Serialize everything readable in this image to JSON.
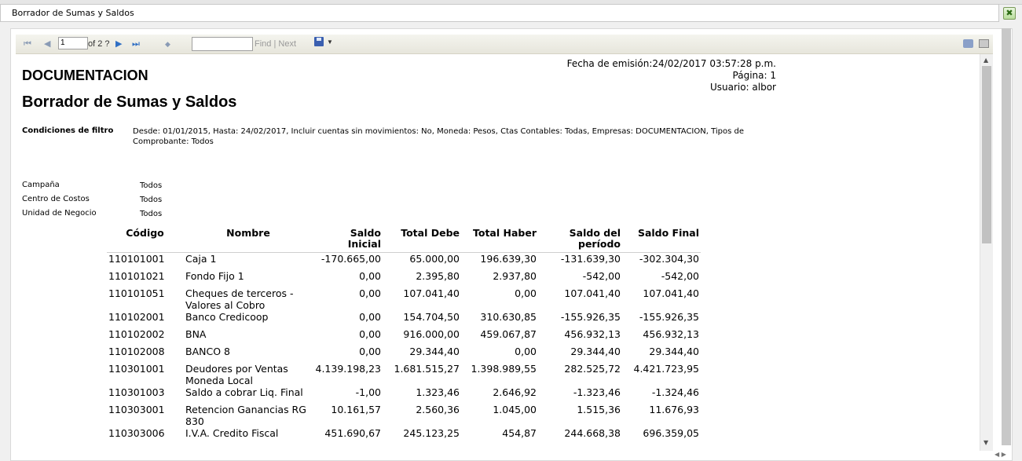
{
  "window": {
    "title": "Borrador de Sumas y Saldos",
    "close_label": "✖"
  },
  "toolbar": {
    "first_icon": "⏮",
    "prev_icon": "◀",
    "page_value": "1",
    "of_text": "of 2 ?",
    "next_icon": "▶",
    "last_icon": "⏭",
    "back_icon": "◆",
    "find_value": "",
    "find_label": "Find",
    "separator": "|",
    "next_label": "Next",
    "export_arrow": "▼"
  },
  "report": {
    "company": "DOCUMENTACION",
    "title": "Borrador de Sumas y Saldos",
    "meta": {
      "fecha": "Fecha de emisión:24/02/2017 03:57:28 p.m.",
      "pagina": "Página: 1",
      "usuario": "Usuario: albor"
    },
    "filter_label": "Condiciones de filtro",
    "filter_text": "Desde: 01/01/2015, Hasta: 24/02/2017, Incluir cuentas sin movimientos: No, Moneda: Pesos, Ctas Contables: Todas, Empresas: DOCUMENTACION, Tipos de Comprobante: Todos",
    "params": [
      {
        "label": "Campaña",
        "value": "Todos"
      },
      {
        "label": "Centro de Costos",
        "value": "Todos"
      },
      {
        "label": "Unidad de Negocio",
        "value": "Todos"
      }
    ],
    "columns": [
      "Código",
      "Nombre",
      "Saldo Inicial",
      "Total Debe",
      "Total Haber",
      "Saldo del período",
      "Saldo Final"
    ],
    "rows": [
      {
        "codigo": "110101001",
        "nombre": "Caja 1",
        "saldo_inicial": "-170.665,00",
        "total_debe": "65.000,00",
        "total_haber": "196.639,30",
        "saldo_periodo": "-131.639,30",
        "saldo_final": "-302.304,30"
      },
      {
        "codigo": "110101021",
        "nombre": "Fondo Fijo 1",
        "saldo_inicial": "0,00",
        "total_debe": "2.395,80",
        "total_haber": "2.937,80",
        "saldo_periodo": "-542,00",
        "saldo_final": "-542,00"
      },
      {
        "codigo": "110101051",
        "nombre": "Cheques de terceros - Valores al Cobro",
        "saldo_inicial": "0,00",
        "total_debe": "107.041,40",
        "total_haber": "0,00",
        "saldo_periodo": "107.041,40",
        "saldo_final": "107.041,40"
      },
      {
        "codigo": "110102001",
        "nombre": "Banco Credicoop",
        "saldo_inicial": "0,00",
        "total_debe": "154.704,50",
        "total_haber": "310.630,85",
        "saldo_periodo": "-155.926,35",
        "saldo_final": "-155.926,35"
      },
      {
        "codigo": "110102002",
        "nombre": "BNA",
        "saldo_inicial": "0,00",
        "total_debe": "916.000,00",
        "total_haber": "459.067,87",
        "saldo_periodo": "456.932,13",
        "saldo_final": "456.932,13"
      },
      {
        "codigo": "110102008",
        "nombre": "BANCO 8",
        "saldo_inicial": "0,00",
        "total_debe": "29.344,40",
        "total_haber": "0,00",
        "saldo_periodo": "29.344,40",
        "saldo_final": "29.344,40"
      },
      {
        "codigo": "110301001",
        "nombre": "Deudores por Ventas Moneda Local",
        "saldo_inicial": "4.139.198,23",
        "total_debe": "1.681.515,27",
        "total_haber": "1.398.989,55",
        "saldo_periodo": "282.525,72",
        "saldo_final": "4.421.723,95"
      },
      {
        "codigo": "110301003",
        "nombre": "Saldo a cobrar Liq. Final",
        "saldo_inicial": "-1,00",
        "total_debe": "1.323,46",
        "total_haber": "2.646,92",
        "saldo_periodo": "-1.323,46",
        "saldo_final": "-1.324,46"
      },
      {
        "codigo": "110303001",
        "nombre": "Retencion Ganancias RG 830",
        "saldo_inicial": "10.161,57",
        "total_debe": "2.560,36",
        "total_haber": "1.045,00",
        "saldo_periodo": "1.515,36",
        "saldo_final": "11.676,93"
      },
      {
        "codigo": "110303006",
        "nombre": "I.V.A. Credito Fiscal",
        "saldo_inicial": "451.690,67",
        "total_debe": "245.123,25",
        "total_haber": "454,87",
        "saldo_periodo": "244.668,38",
        "saldo_final": "696.359,05"
      }
    ]
  }
}
